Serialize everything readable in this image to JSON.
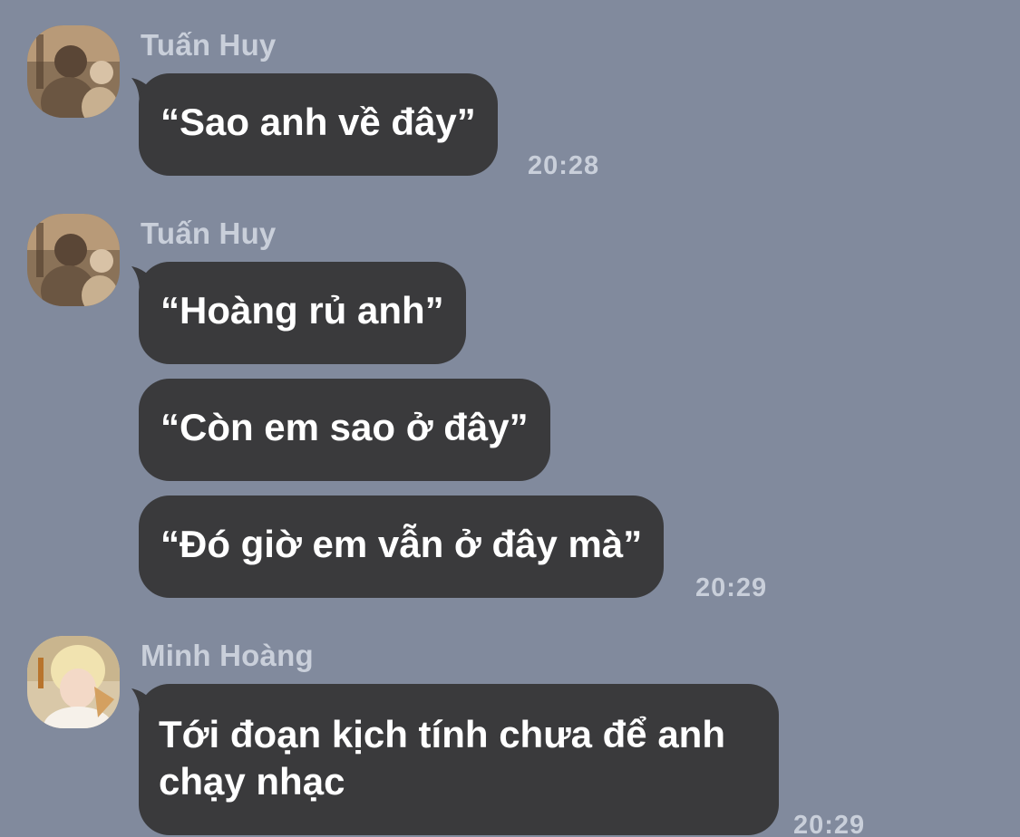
{
  "messages": [
    {
      "sender": "Tuấn Huy",
      "avatar": "avatar-tuan-huy",
      "bubbles": [
        "“Sao anh về đây”"
      ],
      "time": "20:28"
    },
    {
      "sender": "Tuấn Huy",
      "avatar": "avatar-tuan-huy",
      "bubbles": [
        "“Hoàng rủ anh”",
        "“Còn em sao ở đây”",
        "“Đó giờ em vẫn ở đây mà”"
      ],
      "time": "20:29"
    },
    {
      "sender": "Minh Hoàng",
      "avatar": "avatar-minh-hoang",
      "bubbles": [
        "Tới đoạn kịch tính chưa để anh chạy nhạc"
      ],
      "time": "20:29"
    }
  ],
  "colors": {
    "background": "#818a9d",
    "bubble": "#3a3a3c",
    "bubble_text": "#ffffff",
    "meta_text": "#c9cfda"
  }
}
